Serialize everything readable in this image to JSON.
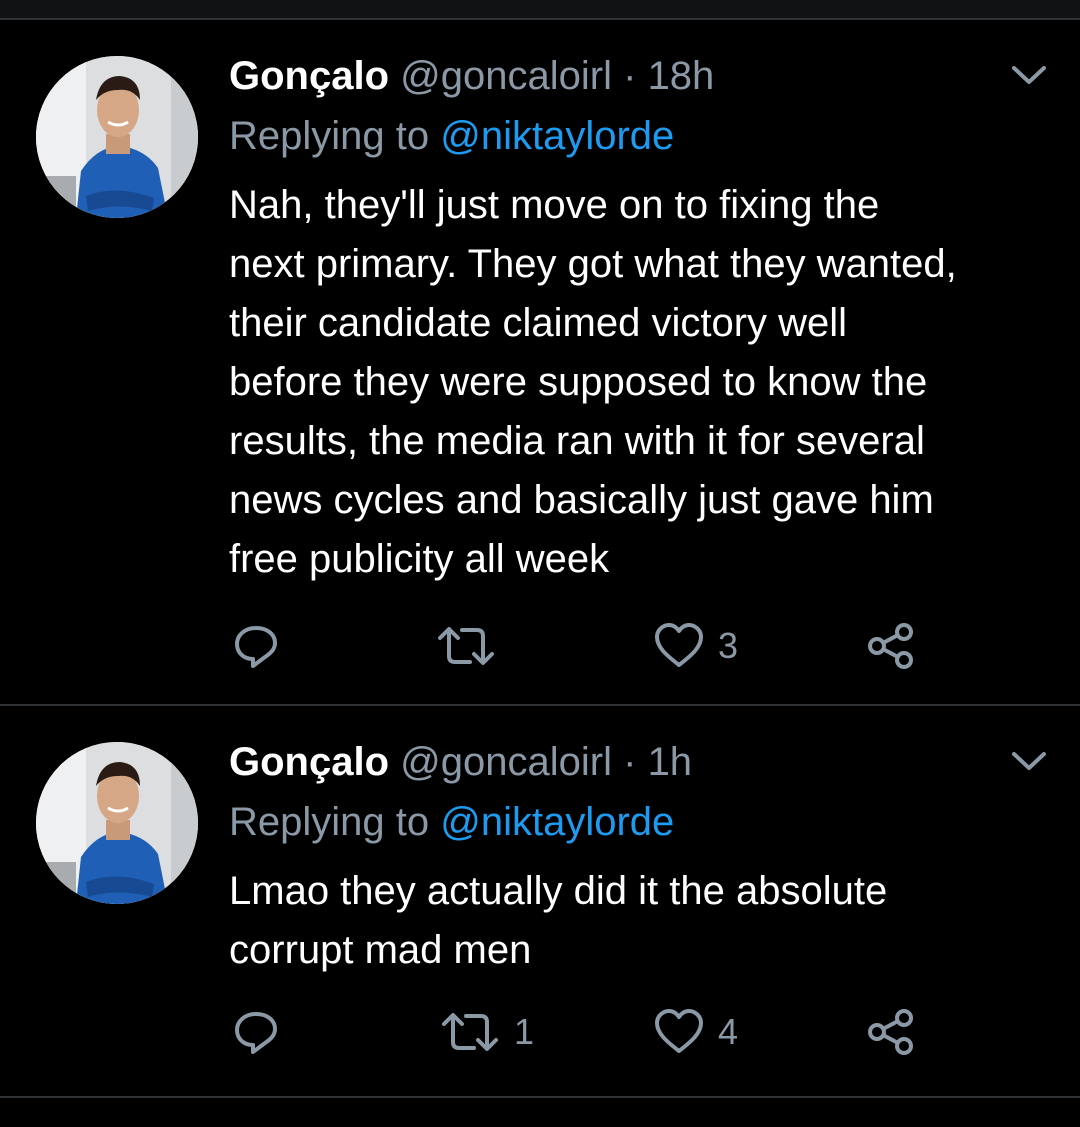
{
  "tweets": [
    {
      "author_name": "Gonçalo",
      "handle": "@goncaloirl",
      "separator": "·",
      "time": "18h",
      "reply_prefix": "Replying to",
      "reply_target": "@niktaylorde",
      "text": "Nah, they'll just move on to fixing the\nnext primary. They got what they wanted,\ntheir candidate claimed victory well\nbefore they were supposed to know the\nresults, the media ran with it for several\nnews cycles and basically just gave him\nfree publicity all week",
      "reply_count": "",
      "retweet_count": "",
      "like_count": "3"
    },
    {
      "author_name": "Gonçalo",
      "handle": "@goncaloirl",
      "separator": "·",
      "time": "1h",
      "reply_prefix": "Replying to",
      "reply_target": "@niktaylorde",
      "text": "Lmao they actually did it the absolute\ncorrupt mad men",
      "reply_count": "",
      "retweet_count": "1",
      "like_count": "4"
    }
  ],
  "icons": {
    "reply": "reply-icon",
    "retweet": "retweet-icon",
    "like": "heart-icon",
    "share": "share-icon",
    "menu": "chevron-down-icon"
  },
  "colors": {
    "background": "#000000",
    "text": "#ffffff",
    "secondary": "#8b98a5",
    "accent": "#1d9bf0",
    "divider": "#2f3336"
  }
}
